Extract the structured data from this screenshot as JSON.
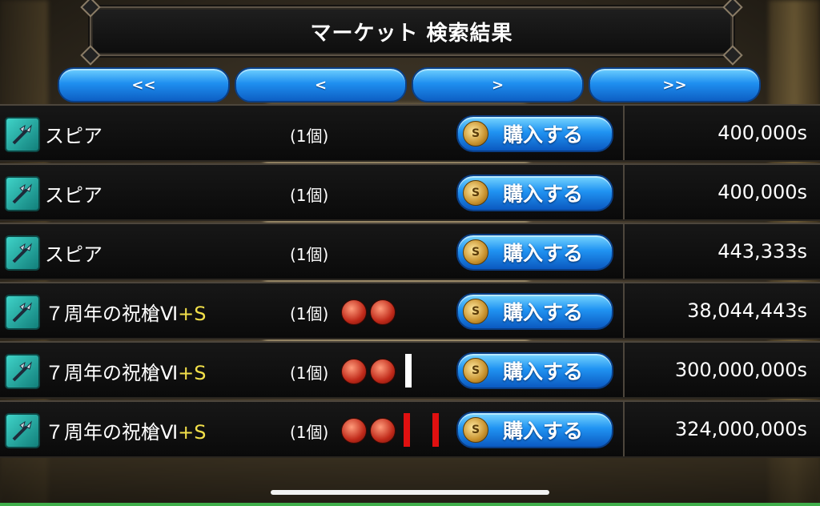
{
  "title": "マーケット 検索結果",
  "nav": {
    "first_label": "<<",
    "prev_label": "<",
    "next_label": ">",
    "last_label": ">>"
  },
  "buy_label": "購入する",
  "icons": {
    "item": "spear-icon",
    "currency": "coin-icon",
    "gem": "red-gem-icon"
  },
  "colors": {
    "button_blue": "#1f8ff0",
    "plus_yellow": "#f2e04a",
    "mark_white": "#ffffff",
    "mark_red": "#e01010"
  },
  "items": [
    {
      "name": "スピア",
      "plus": "",
      "count": "(1個)",
      "gems": 0,
      "marks": [],
      "price": "400,000s"
    },
    {
      "name": "スピア",
      "plus": "",
      "count": "(1個)",
      "gems": 0,
      "marks": [],
      "price": "400,000s"
    },
    {
      "name": "スピア",
      "plus": "",
      "count": "(1個)",
      "gems": 0,
      "marks": [],
      "price": "443,333s"
    },
    {
      "name": "７周年の祝槍Ⅵ",
      "plus": "+S",
      "count": "(1個)",
      "gems": 2,
      "marks": [],
      "price": "38,044,443s"
    },
    {
      "name": "７周年の祝槍Ⅵ",
      "plus": "+S",
      "count": "(1個)",
      "gems": 2,
      "marks": [
        "white"
      ],
      "price": "300,000,000s"
    },
    {
      "name": "７周年の祝槍Ⅵ",
      "plus": "+S",
      "count": "(1個)",
      "gems": 2,
      "marks": [
        "red",
        "red"
      ],
      "price": "324,000,000s"
    }
  ]
}
